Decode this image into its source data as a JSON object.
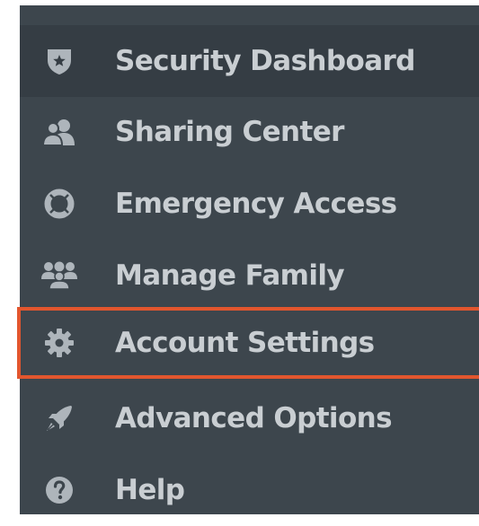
{
  "sidebar": {
    "items": [
      {
        "label": "Security Dashboard",
        "icon": "shield-star-icon"
      },
      {
        "label": "Sharing Center",
        "icon": "users-share-icon"
      },
      {
        "label": "Emergency Access",
        "icon": "life-ring-icon"
      },
      {
        "label": "Manage Family",
        "icon": "family-icon"
      },
      {
        "label": "Account Settings",
        "icon": "gear-icon"
      },
      {
        "label": "Advanced Options",
        "icon": "rocket-icon"
      },
      {
        "label": "Help",
        "icon": "question-icon"
      }
    ]
  },
  "colors": {
    "background": "#3d464d",
    "active_background": "#353d44",
    "text": "#c9ced2",
    "icon": "#aeb5bb",
    "highlight_border": "#e2562e"
  }
}
